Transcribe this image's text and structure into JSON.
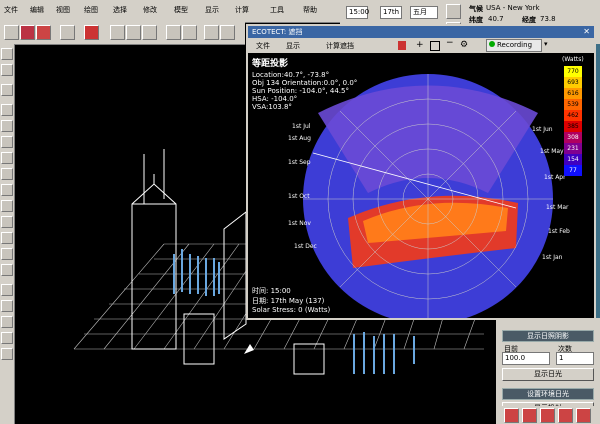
{
  "menu": [
    "文件",
    "编辑",
    "视图",
    "绘图",
    "选择",
    "修改",
    "模型",
    "显示",
    "计算",
    "工具",
    "帮助"
  ],
  "date_time": {
    "time": "15:00",
    "day": "17th",
    "month": "五月"
  },
  "location": {
    "weather_label": "气候",
    "weather_value": "USA - New York",
    "lat_label": "纬度",
    "lat_value": "40.7",
    "lon_label": "经度",
    "lon_value": "73.8"
  },
  "eco_window": {
    "title": "ECOTECT: 遮挡",
    "menu": [
      "文件",
      "显示",
      "计算遮挡"
    ],
    "recording": "Recording",
    "plot_title": "等距投影",
    "info_lines": [
      "Location:40.7°, -73.8°",
      "Obj 134 Orientation:0.0°, 0.0°",
      "Sun Position: -104.0°, 44.5°",
      "HSA: -104.0°",
      "VSA:103.8°"
    ],
    "bottom_info": [
      "时间: 15:00",
      "日期: 17th May (137)",
      "Solar Stress: 0 (Watts)"
    ],
    "legend_unit": "Watts",
    "legend_values": [
      "770",
      "693",
      "616",
      "539",
      "462",
      "385",
      "308",
      "231",
      "154",
      "77"
    ],
    "legend_colors": [
      "#ffff00",
      "#ffcc00",
      "#ff9900",
      "#ff6600",
      "#ff3300",
      "#dd0000",
      "#b00060",
      "#800090",
      "#4000c0",
      "#1010ff"
    ],
    "month_labels_left": [
      "1st Jul",
      "1st Aug",
      "1st Sep",
      "1st Oct",
      "1st Nov",
      "1st Dec"
    ],
    "month_labels_right": [
      "1st Jun",
      "1st May",
      "1st Apr",
      "1st Mar",
      "1st Feb",
      "1st Jan"
    ]
  },
  "right_panel": {
    "section1_title": "显示日照阴影",
    "field1_label": "目前",
    "field2_label": "次数",
    "field1_value": "100.0",
    "field2_value": "1",
    "button1": "显示日光",
    "section2_title": "设置环境日光",
    "button2": "显示投射"
  }
}
